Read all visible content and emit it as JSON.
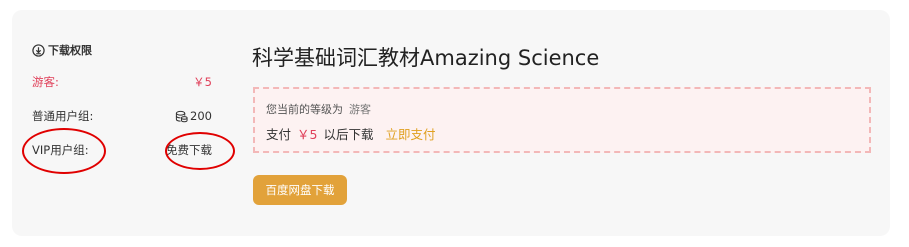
{
  "permissions": {
    "title": "下载权限",
    "rows": [
      {
        "label": "游客:",
        "value": "￥5"
      },
      {
        "label": "普通用户组:",
        "value": "200"
      },
      {
        "label": "VIP用户组:",
        "value": "免费下载"
      }
    ]
  },
  "resource": {
    "title": "科学基础词汇教材Amazing Science"
  },
  "notice": {
    "level_prefix": "您当前的等级为",
    "level_value": "游客",
    "pay_prefix": "支付",
    "price": "￥5",
    "pay_suffix": "以后下载",
    "pay_link": "立即支付"
  },
  "download_button": "百度网盘下载",
  "colors": {
    "accent": "#e2a23a",
    "price": "#e0405a",
    "annotation_circle": "#e00000"
  }
}
